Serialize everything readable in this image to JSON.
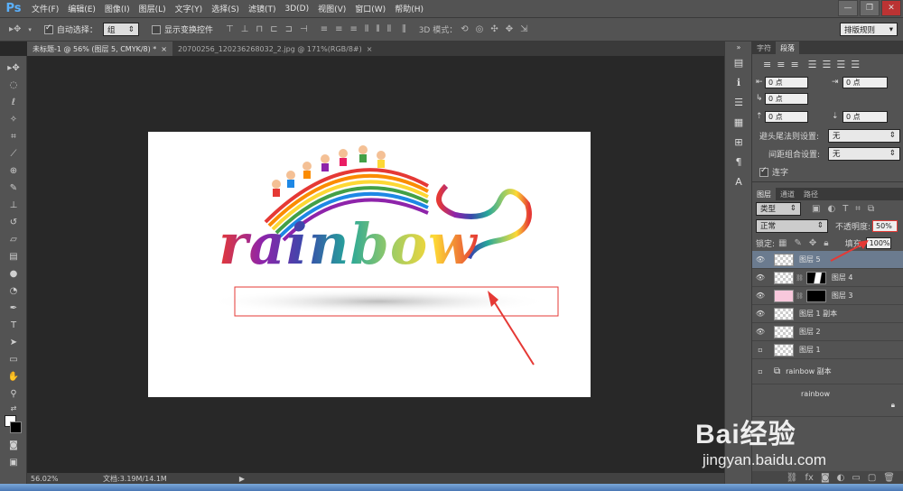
{
  "menubar": {
    "logo": "Ps",
    "items": [
      "文件(F)",
      "编辑(E)",
      "图像(I)",
      "图层(L)",
      "文字(Y)",
      "选择(S)",
      "滤镜(T)",
      "3D(D)",
      "视图(V)",
      "窗口(W)",
      "帮助(H)"
    ],
    "minimize": "—",
    "restore": "❐",
    "close": "✕"
  },
  "options": {
    "auto_select_label": "自动选择：",
    "auto_select_value": "组",
    "show_transform_label": "显示变换控件",
    "mode_3d_label": "3D 模式：",
    "workspace": "排版规则"
  },
  "tabs": [
    {
      "label": "未标题-1 @ 56% (图层 5, CMYK/8) *",
      "close": "×"
    },
    {
      "label": "20700256_120236268032_2.jpg @ 171%(RGB/8#)",
      "close": "×"
    }
  ],
  "status": {
    "zoom": "56.02%",
    "doc": "文档:3.19M/14.1M"
  },
  "canvas": {
    "logo_text": "rainbow"
  },
  "char_panel": {
    "tabs": [
      "字符",
      "段落"
    ],
    "indent_left": "0 点",
    "indent_right": "0 点",
    "first_line": "0 点",
    "space_before": "0 点",
    "space_after": "0 点",
    "hyphen_label": "避头尾法则设置:",
    "hyphen_value": "无",
    "spacing_label": "间距组合设置:",
    "spacing_value": "无",
    "lianzi": "连字"
  },
  "layers_panel": {
    "tabs": [
      "图层",
      "通道",
      "路径"
    ],
    "filter": "类型",
    "blend_mode": "正常",
    "opacity_label": "不透明度:",
    "opacity_value": "50%",
    "lock_label": "锁定:",
    "fill_label": "填充:",
    "fill_value": "100%",
    "layers": [
      {
        "name": "图层 5",
        "visible": true,
        "selected": true,
        "mask": false
      },
      {
        "name": "图层 4",
        "visible": true,
        "selected": false,
        "mask": true
      },
      {
        "name": "图层 3",
        "visible": true,
        "selected": false,
        "mask": true
      },
      {
        "name": "图层 1 副本",
        "visible": true,
        "selected": false,
        "mask": false
      },
      {
        "name": "图层 2",
        "visible": true,
        "selected": false,
        "mask": false
      },
      {
        "name": "图层 1",
        "visible": false,
        "selected": false,
        "mask": false
      },
      {
        "name": "rainbow 副本",
        "visible": false,
        "selected": false,
        "mask": false
      },
      {
        "name": "rainbow",
        "visible": false,
        "selected": false,
        "mask": false
      }
    ]
  },
  "watermark": {
    "brand": "Bai经验",
    "url": "jingyan.baidu.com"
  },
  "colors": {
    "accent_red": "#e53935",
    "selection_blue": "#6b7b8f"
  }
}
